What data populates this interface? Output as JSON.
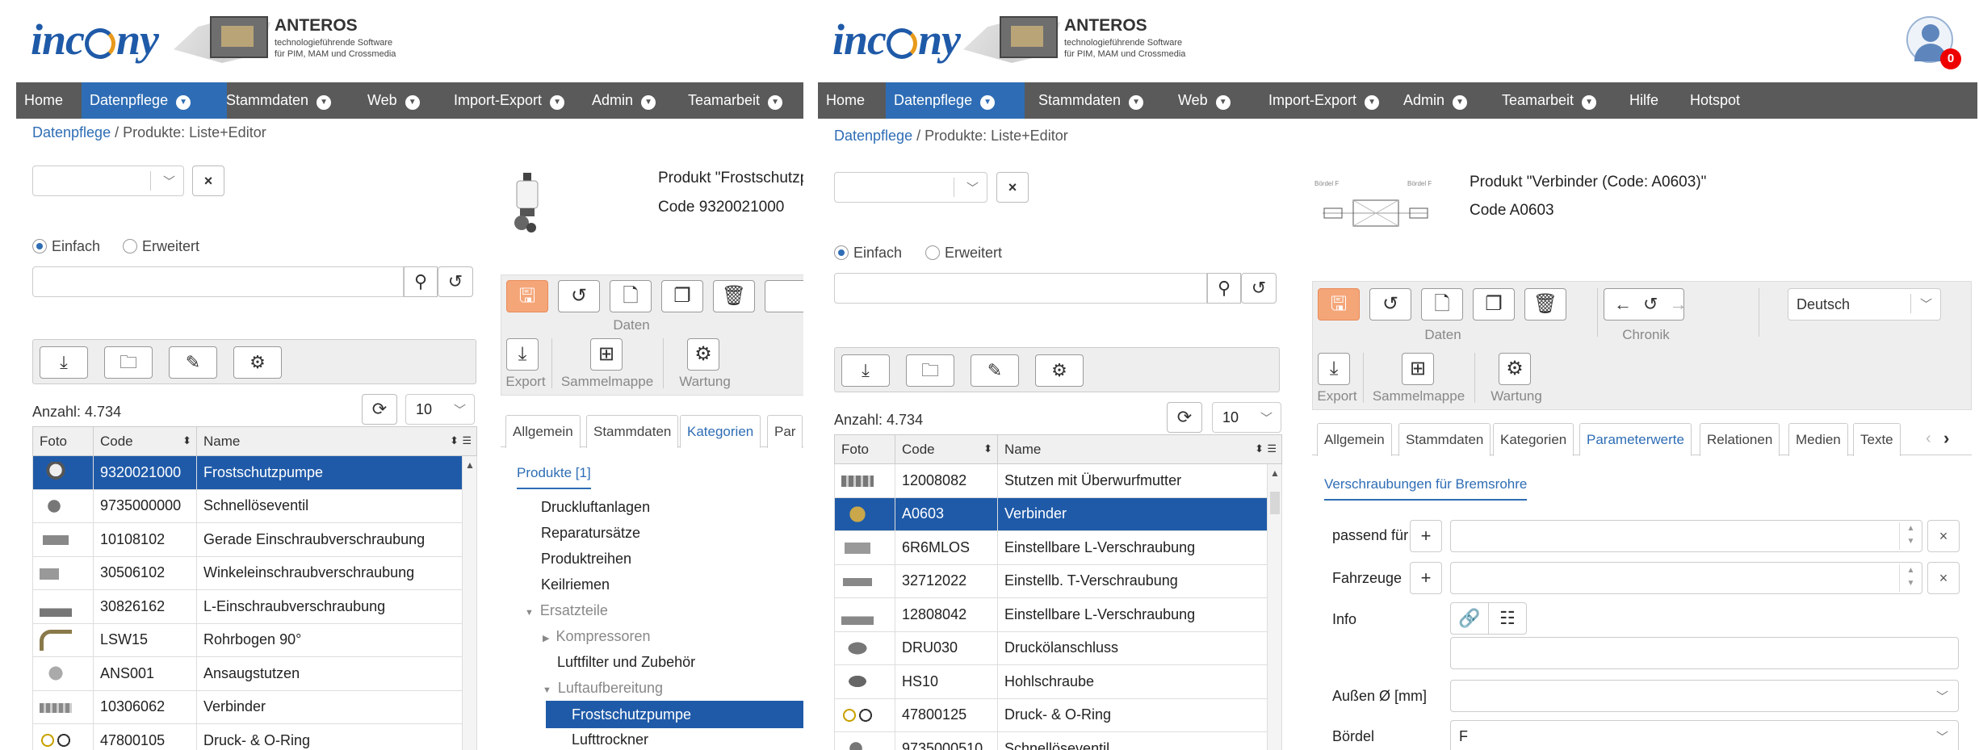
{
  "brand": {
    "logo": "incony",
    "product": "ANTEROS",
    "tagline_1": "technologieführende Software",
    "tagline_2": "für PIM, MAM und Crossmedia"
  },
  "user": {
    "notifications": "0"
  },
  "menu": {
    "items": [
      "Home",
      "Datenpflege",
      "Stammdaten",
      "Web",
      "Import-Export",
      "Admin",
      "Teamarbeit",
      "Hilfe",
      "Hotspot"
    ],
    "active": "Datenpflege"
  },
  "breadcrumb": {
    "link": "Datenpflege",
    "separator": " / ",
    "current": "Produkte: Liste+Editor"
  },
  "search": {
    "mode_simple": "Einfach",
    "mode_extended": "Erweitert",
    "close_label": "×"
  },
  "list": {
    "count_label": "Anzahl: 4.734",
    "page_size": "10",
    "columns": [
      "Foto",
      "Code",
      "Name"
    ]
  },
  "left": {
    "rows": [
      {
        "code": "9320021000",
        "name": "Frostschutzpumpe",
        "selected": true
      },
      {
        "code": "9735000000",
        "name": "Schnellöseventil"
      },
      {
        "code": "10108102",
        "name": "Gerade Einschraubverschraubung"
      },
      {
        "code": "30506102",
        "name": "Winkeleinschraubverschraubung"
      },
      {
        "code": "30826162",
        "name": "L-Einschraubverschraubung"
      },
      {
        "code": "LSW15",
        "name": "Rohrbogen 90°"
      },
      {
        "code": "ANS001",
        "name": "Ansaugstutzen"
      },
      {
        "code": "10306062",
        "name": "Verbinder"
      },
      {
        "code": "47800105",
        "name": "Druck- & O-Ring"
      }
    ],
    "product_title": "Produkt \"Frostschutzp",
    "product_code": "Code  9320021000",
    "group_daten": "Daten",
    "export": "Export",
    "sammelmappe": "Sammelmappe",
    "wartung": "Wartung",
    "tabs": [
      "Allgemein",
      "Stammdaten",
      "Kategorien",
      "Par"
    ],
    "active_tab": "Kategorien",
    "subtab": "Produkte [1]",
    "tree": {
      "t1": "Druckluftanlagen",
      "t2": "Reparatursätze",
      "t3": "Produktreihen",
      "t4": "Keilriemen",
      "t5": "Ersatzteile",
      "t6": "Kompressoren",
      "t7": "Luftfilter und Zubehör",
      "t8": "Luftaufbereitung",
      "t9": "Frostschutzpumpe",
      "t10": "Lufttrockner"
    }
  },
  "right": {
    "rows": [
      {
        "code": "12008082",
        "name": "Stutzen mit Überwurfmutter"
      },
      {
        "code": "A0603",
        "name": "Verbinder",
        "selected": true
      },
      {
        "code": "6R6MLOS",
        "name": "Einstellbare L-Verschraubung"
      },
      {
        "code": "32712022",
        "name": "Einstellb. T-Verschraubung"
      },
      {
        "code": "12808042",
        "name": "Einstellbare L-Verschraubung"
      },
      {
        "code": "DRU030",
        "name": "Druckölanschluss"
      },
      {
        "code": "HS10",
        "name": "Hohlschraube"
      },
      {
        "code": "47800125",
        "name": "Druck- & O-Ring"
      },
      {
        "code": "9735000510",
        "name": "Schnellöseventil"
      }
    ],
    "product_title": "Produkt \"Verbinder (Code: A0603)\"",
    "product_code": "Code  A0603",
    "drawing_label_1": "Bördel F",
    "drawing_label_2": "Bördel F",
    "group_daten": "Daten",
    "group_chronik": "Chronik",
    "export": "Export",
    "sammelmappe": "Sammelmappe",
    "wartung": "Wartung",
    "language": "Deutsch",
    "tabs": [
      "Allgemein",
      "Stammdaten",
      "Kategorien",
      "Parameterwerte",
      "Relationen",
      "Medien",
      "Texte"
    ],
    "active_tab": "Parameterwerte",
    "subtab": "Verschraubungen für Bremsrohre",
    "form": {
      "passend_label": "passend für",
      "fahrzeuge_label": "Fahrzeuge",
      "info_label": "Info",
      "aussen_label": "Außen Ø [mm]",
      "boerdel_label": "Bördel",
      "boerdel_value": "F",
      "plus": "+",
      "close": "×"
    }
  },
  "colors": {
    "accent": "#1f5aa8",
    "menubar": "#5a5a5a",
    "save": "#f5a679"
  }
}
